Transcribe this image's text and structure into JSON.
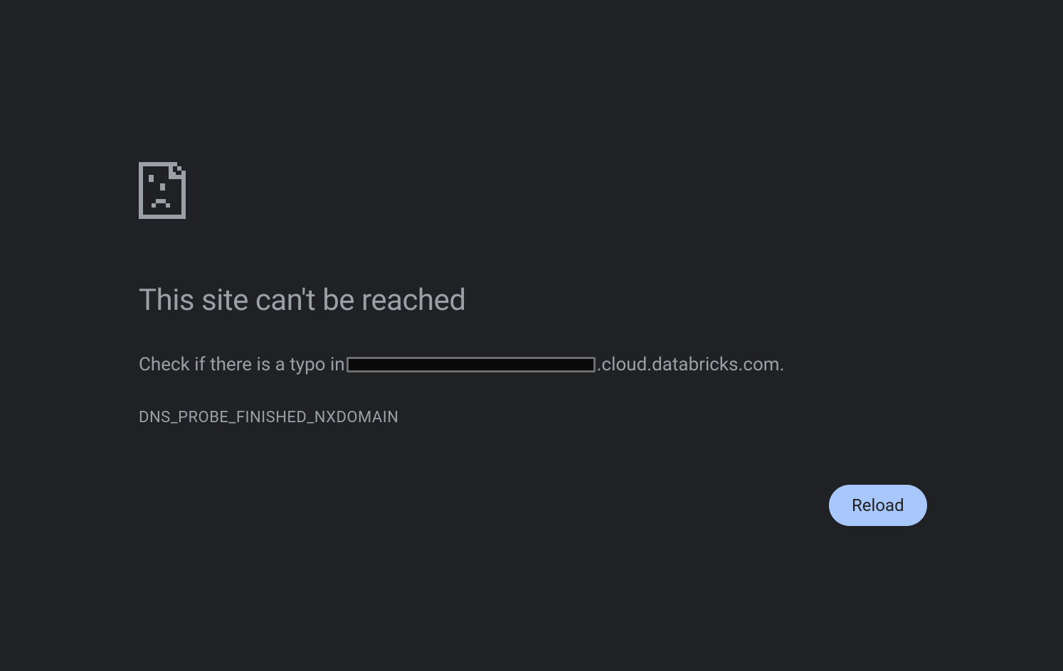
{
  "error": {
    "title": "This site can't be reached",
    "message_prefix": "Check if there is a typo in",
    "message_suffix": ".cloud.databricks.com.",
    "code": "DNS_PROBE_FINISHED_NXDOMAIN"
  },
  "actions": {
    "reload_label": "Reload"
  }
}
